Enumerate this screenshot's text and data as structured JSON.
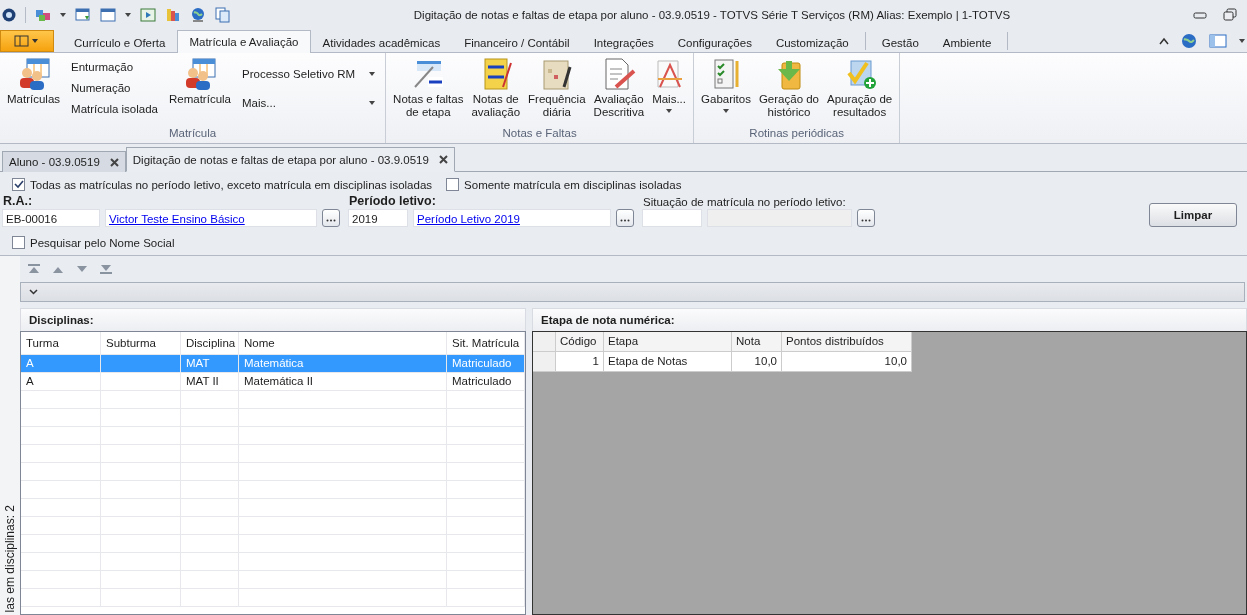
{
  "window": {
    "title": "Digitação de notas e faltas de etapa por aluno - 03.9.0519 - TOTVS Série T Serviços (RM) Alias: Exemplo | 1-TOTVS"
  },
  "ribbon_tabs": [
    {
      "label": "Currículo e Oferta",
      "selected": false
    },
    {
      "label": "Matrícula e Avaliação",
      "selected": true
    },
    {
      "label": "Atividades acadêmicas",
      "selected": false
    },
    {
      "label": "Financeiro / Contábil",
      "selected": false
    },
    {
      "label": "Integrações",
      "selected": false
    },
    {
      "label": "Configurações",
      "selected": false
    },
    {
      "label": "Customização",
      "selected": false
    },
    {
      "label": "Gestão",
      "selected": false
    },
    {
      "label": "Ambiente",
      "selected": false
    }
  ],
  "ribbon_groups": [
    {
      "caption": "Matrícula",
      "items": [
        {
          "kind": "large",
          "lines": [
            "Matrículas"
          ],
          "dropdown": false
        },
        {
          "kind": "stack",
          "entries": [
            {
              "label": "Enturmação",
              "dropdown": false
            },
            {
              "label": "Numeração",
              "dropdown": false
            },
            {
              "label": "Matrícula isolada",
              "dropdown": false
            }
          ]
        },
        {
          "kind": "large",
          "lines": [
            "Rematrícula"
          ],
          "dropdown": false
        },
        {
          "kind": "stack",
          "entries": [
            {
              "label": "Processo Seletivo RM",
              "dropdown": true
            },
            {
              "label": "Mais...",
              "dropdown": true
            }
          ]
        }
      ]
    },
    {
      "caption": "Notas e Faltas",
      "items": [
        {
          "kind": "large",
          "lines": [
            "Notas e faltas",
            "de etapa"
          ],
          "dropdown": false
        },
        {
          "kind": "large",
          "lines": [
            "Notas de",
            "avaliação"
          ],
          "dropdown": false
        },
        {
          "kind": "large",
          "lines": [
            "Frequência",
            "diária"
          ],
          "dropdown": false
        },
        {
          "kind": "large",
          "lines": [
            "Avaliação",
            "Descritiva"
          ],
          "dropdown": false
        },
        {
          "kind": "large",
          "lines": [
            "Mais..."
          ],
          "dropdown": true
        }
      ]
    },
    {
      "caption": "Rotinas periódicas",
      "items": [
        {
          "kind": "large",
          "lines": [
            "Gabaritos"
          ],
          "dropdown": true
        },
        {
          "kind": "large",
          "lines": [
            "Geração do",
            "histórico"
          ],
          "dropdown": false
        },
        {
          "kind": "large",
          "lines": [
            "Apuração de",
            "resultados"
          ],
          "dropdown": false
        }
      ]
    }
  ],
  "doc_tabs": [
    {
      "label": "Aluno - 03.9.0519",
      "selected": false
    },
    {
      "label": "Digitação de notas e faltas de etapa por aluno - 03.9.0519",
      "selected": true
    }
  ],
  "filters": [
    {
      "label": "Todas as matrículas no período letivo, exceto matrícula em disciplinas isoladas",
      "checked": true
    },
    {
      "label": "Somente matrícula em disciplinas isoladas",
      "checked": false
    }
  ],
  "ra": {
    "label": "R.A.:",
    "code": "EB-00016",
    "name": "Victor Teste Ensino Básico"
  },
  "periodo": {
    "label": "Período letivo:",
    "code": "2019",
    "name": "Período Letivo 2019"
  },
  "situacao": {
    "label": "Situação de matrícula no período letivo:"
  },
  "clear_button": "Limpar",
  "social_name": {
    "label": "Pesquisar pelo Nome Social",
    "checked": false
  },
  "side_label": "las em disciplinas: 2",
  "disciplinas": {
    "title": "Disciplinas:",
    "columns": [
      "Turma",
      "Subturma",
      "Disciplina",
      "Nome",
      "Sit. Matrícula"
    ],
    "rows": [
      {
        "cells": [
          "A",
          "",
          "MAT",
          "Matemática",
          "Matriculado"
        ],
        "selected": true
      },
      {
        "cells": [
          "A",
          "",
          "MAT II",
          "Matemática II",
          "Matriculado"
        ],
        "selected": false
      }
    ]
  },
  "etapas": {
    "title": "Etapa de nota numérica:",
    "columns": [
      "Código",
      "Etapa",
      "Nota",
      "Pontos distribuídos"
    ],
    "rows": [
      {
        "cells": [
          "1",
          "Etapa de Notas",
          "10,0",
          "10,0"
        ]
      }
    ]
  }
}
